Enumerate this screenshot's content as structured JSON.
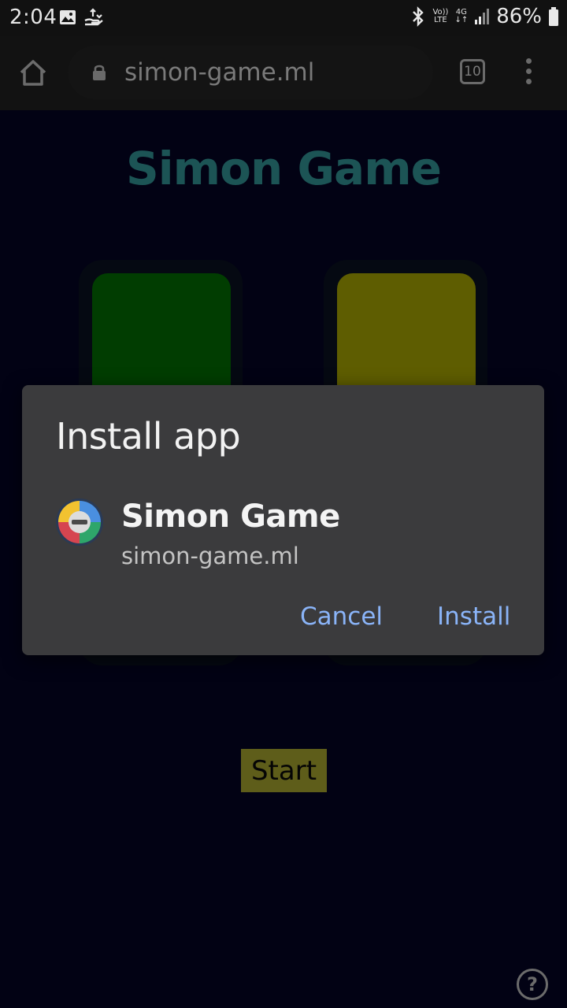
{
  "status_bar": {
    "time": "2:04",
    "lte_top": "Vo))",
    "lte_bottom": "LTE",
    "net_top": "4G",
    "net_bottom": "↓↑",
    "battery": "86%"
  },
  "browser": {
    "url": "simon-game.ml",
    "tab_count": "10"
  },
  "page": {
    "title": "Simon Game",
    "start_label": "Start",
    "help_label": "?",
    "pad_colors": {
      "green": "#013d01",
      "yellow": "#5e5d01"
    }
  },
  "dialog": {
    "title": "Install app",
    "app_name": "Simon Game",
    "app_url": "simon-game.ml",
    "cancel_label": "Cancel",
    "install_label": "Install",
    "button_color": "#8ab4f8"
  }
}
